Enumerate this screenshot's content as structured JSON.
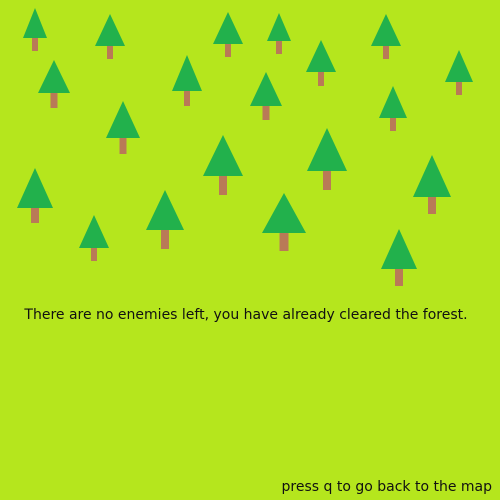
{
  "colors": {
    "grass": "#b5e61d",
    "tree_canopy": "#22b14c",
    "tree_trunk": "#b97a57",
    "text": "#111111"
  },
  "scene": {
    "icon": "pine-tree-icon",
    "message": "There are no enemies left, you have already cleared the forest.",
    "hint": "press q to go back to the map"
  }
}
